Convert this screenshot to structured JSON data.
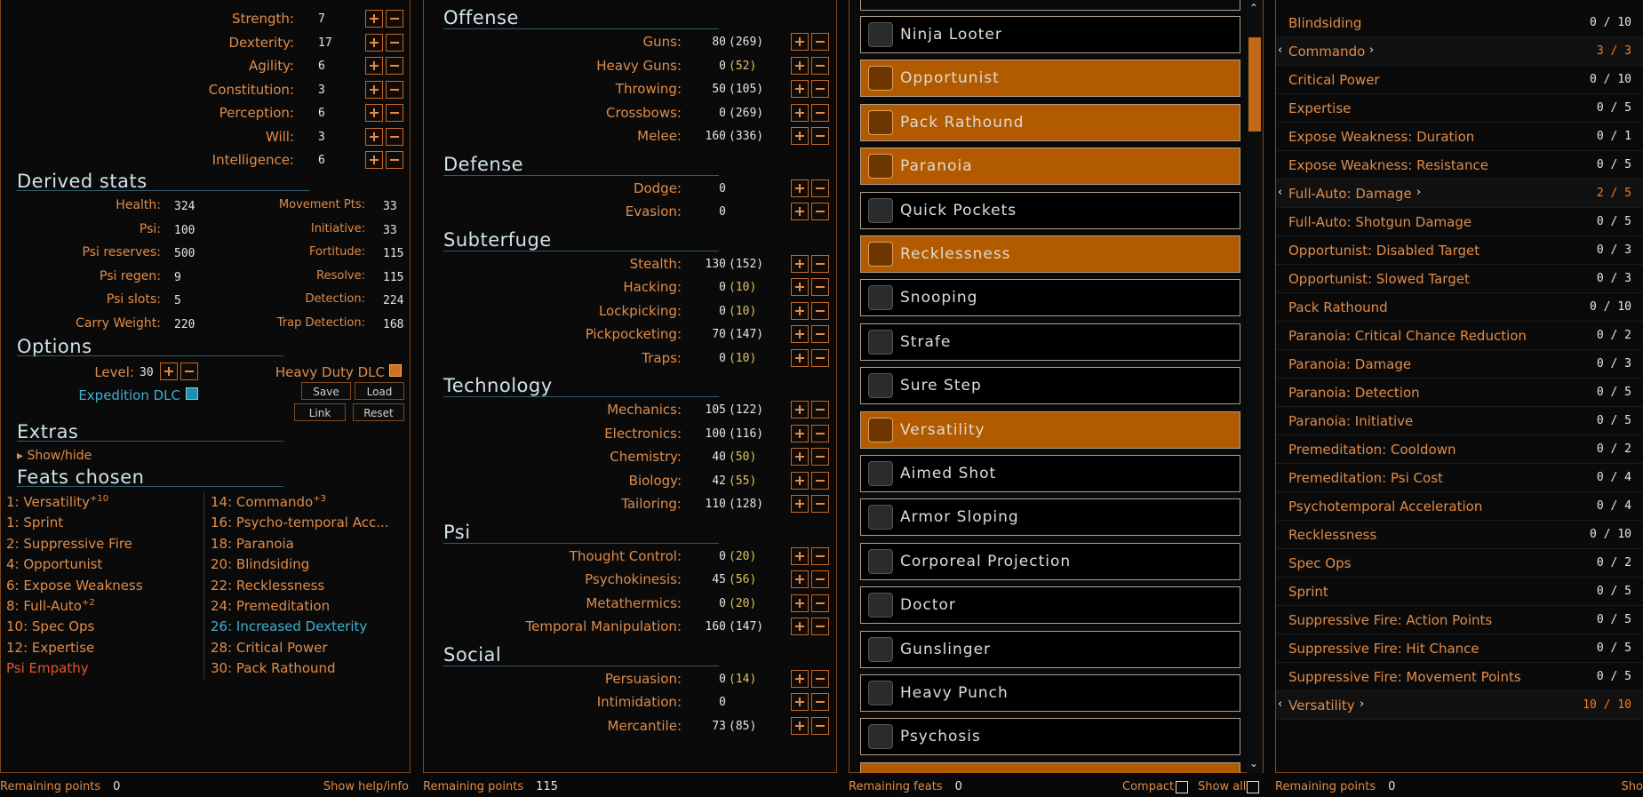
{
  "stats": {
    "attributes": [
      {
        "label": "Strength:",
        "value": "7"
      },
      {
        "label": "Dexterity:",
        "value": "17"
      },
      {
        "label": "Agility:",
        "value": "6"
      },
      {
        "label": "Constitution:",
        "value": "3"
      },
      {
        "label": "Perception:",
        "value": "6"
      },
      {
        "label": "Will:",
        "value": "3"
      },
      {
        "label": "Intelligence:",
        "value": "6"
      }
    ],
    "derived_title": "Derived stats",
    "derived_left": [
      {
        "label": "Health:",
        "value": "324"
      },
      {
        "label": "Psi:",
        "value": "100"
      },
      {
        "label": "Psi reserves:",
        "value": "500"
      },
      {
        "label": "Psi regen:",
        "value": "9"
      },
      {
        "label": "Psi slots:",
        "value": "5"
      },
      {
        "label": "Carry Weight:",
        "value": "220"
      }
    ],
    "derived_right": [
      {
        "label": "Movement Pts:",
        "value": "33"
      },
      {
        "label": "Initiative:",
        "value": "33"
      },
      {
        "label": "Fortitude:",
        "value": "115"
      },
      {
        "label": "Resolve:",
        "value": "115"
      },
      {
        "label": "Detection:",
        "value": "224"
      },
      {
        "label": "Trap Detection:",
        "value": "168"
      }
    ],
    "options_title": "Options",
    "level_label": "Level:",
    "level_value": "30",
    "heavy_duty_label": "Heavy Duty DLC",
    "expedition_label": "Expedition DLC",
    "save_label": "Save",
    "load_label": "Load",
    "link_label": "Link",
    "reset_label": "Reset",
    "extras_title": "Extras",
    "show_hide": "▸ Show/hide",
    "feats_title": "Feats chosen",
    "feats_left": [
      {
        "text": "1: Versatility",
        "sup": "+10",
        "color": "orange"
      },
      {
        "text": "1: Sprint",
        "sup": "",
        "color": "orange"
      },
      {
        "text": "2: Suppressive Fire",
        "sup": "",
        "color": "orange"
      },
      {
        "text": "4: Opportunist",
        "sup": "",
        "color": "orange"
      },
      {
        "text": "6: Expose Weakness",
        "sup": "",
        "color": "orange"
      },
      {
        "text": "8: Full-Auto",
        "sup": "+2",
        "color": "orange"
      },
      {
        "text": "10: Spec Ops",
        "sup": "",
        "color": "orange"
      },
      {
        "text": "12: Expertise",
        "sup": "",
        "color": "orange"
      },
      {
        "text": "Psi Empathy",
        "sup": "",
        "color": "red"
      }
    ],
    "feats_right": [
      {
        "text": "14: Commando",
        "sup": "+3",
        "color": "orange"
      },
      {
        "text": "16: Psycho-temporal Acc...",
        "sup": "",
        "color": "orange"
      },
      {
        "text": "18: Paranoia",
        "sup": "",
        "color": "orange"
      },
      {
        "text": "20: Blindsiding",
        "sup": "",
        "color": "orange"
      },
      {
        "text": "22: Recklessness",
        "sup": "",
        "color": "orange"
      },
      {
        "text": "24: Premeditation",
        "sup": "",
        "color": "orange"
      },
      {
        "text": "26: Increased Dexterity",
        "sup": "",
        "color": "cyan"
      },
      {
        "text": "28: Critical Power",
        "sup": "",
        "color": "orange"
      },
      {
        "text": "30: Pack Rathound",
        "sup": "",
        "color": "orange"
      }
    ],
    "remaining_label": "Remaining points",
    "remaining_value": "0",
    "help_label": "Show help/info"
  },
  "skills": {
    "sections": [
      {
        "title": "Offense",
        "rows": [
          {
            "label": "Guns:",
            "value": "80",
            "eff": "(269)",
            "eff_color": "white"
          },
          {
            "label": "Heavy Guns:",
            "value": "0",
            "eff": "(52)",
            "eff_color": "yellow"
          },
          {
            "label": "Throwing:",
            "value": "50",
            "eff": "(105)",
            "eff_color": "white"
          },
          {
            "label": "Crossbows:",
            "value": "0",
            "eff": "(269)",
            "eff_color": "white"
          },
          {
            "label": "Melee:",
            "value": "160",
            "eff": "(336)",
            "eff_color": "white"
          }
        ]
      },
      {
        "title": "Defense",
        "rows": [
          {
            "label": "Dodge:",
            "value": "0",
            "eff": "",
            "eff_color": "white"
          },
          {
            "label": "Evasion:",
            "value": "0",
            "eff": "",
            "eff_color": "white"
          }
        ]
      },
      {
        "title": "Subterfuge",
        "rows": [
          {
            "label": "Stealth:",
            "value": "130",
            "eff": "(152)",
            "eff_color": "white"
          },
          {
            "label": "Hacking:",
            "value": "0",
            "eff": "(10)",
            "eff_color": "yellow"
          },
          {
            "label": "Lockpicking:",
            "value": "0",
            "eff": "(10)",
            "eff_color": "yellow"
          },
          {
            "label": "Pickpocketing:",
            "value": "70",
            "eff": "(147)",
            "eff_color": "white"
          },
          {
            "label": "Traps:",
            "value": "0",
            "eff": "(10)",
            "eff_color": "yellow"
          }
        ]
      },
      {
        "title": "Technology",
        "rows": [
          {
            "label": "Mechanics:",
            "value": "105",
            "eff": "(122)",
            "eff_color": "white"
          },
          {
            "label": "Electronics:",
            "value": "100",
            "eff": "(116)",
            "eff_color": "white"
          },
          {
            "label": "Chemistry:",
            "value": "40",
            "eff": "(50)",
            "eff_color": "yellow"
          },
          {
            "label": "Biology:",
            "value": "42",
            "eff": "(55)",
            "eff_color": "yellow"
          },
          {
            "label": "Tailoring:",
            "value": "110",
            "eff": "(128)",
            "eff_color": "white"
          }
        ]
      },
      {
        "title": "Psi",
        "rows": [
          {
            "label": "Thought Control:",
            "value": "0",
            "eff": "(20)",
            "eff_color": "yellow"
          },
          {
            "label": "Psychokinesis:",
            "value": "45",
            "eff": "(56)",
            "eff_color": "yellow"
          },
          {
            "label": "Metathermics:",
            "value": "0",
            "eff": "(20)",
            "eff_color": "yellow"
          },
          {
            "label": "Temporal Manipulation:",
            "value": "160",
            "eff": "(147)",
            "eff_color": "white"
          }
        ]
      },
      {
        "title": "Social",
        "rows": [
          {
            "label": "Persuasion:",
            "value": "0",
            "eff": "(14)",
            "eff_color": "yellow"
          },
          {
            "label": "Intimidation:",
            "value": "0",
            "eff": "",
            "eff_color": "white"
          },
          {
            "label": "Mercantile:",
            "value": "73",
            "eff": "(85)",
            "eff_color": "white"
          }
        ]
      }
    ],
    "remaining_label": "Remaining points",
    "remaining_value": "115"
  },
  "feats": {
    "items": [
      {
        "name": "Ninja Looter",
        "selected": false,
        "icon": "ninja-looter-icon"
      },
      {
        "name": "Opportunist",
        "selected": true,
        "icon": "opportunist-icon"
      },
      {
        "name": "Pack Rathound",
        "selected": true,
        "icon": "pack-rathound-icon"
      },
      {
        "name": "Paranoia",
        "selected": true,
        "icon": "paranoia-icon"
      },
      {
        "name": "Quick Pockets",
        "selected": false,
        "icon": "quick-pockets-icon"
      },
      {
        "name": "Recklessness",
        "selected": true,
        "icon": "recklessness-icon"
      },
      {
        "name": "Snooping",
        "selected": false,
        "icon": "snooping-icon"
      },
      {
        "name": "Strafe",
        "selected": false,
        "icon": "strafe-icon"
      },
      {
        "name": "Sure Step",
        "selected": false,
        "icon": "sure-step-icon"
      },
      {
        "name": "Versatility",
        "selected": true,
        "icon": "versatility-icon"
      },
      {
        "name": "Aimed Shot",
        "selected": false,
        "icon": "aimed-shot-icon"
      },
      {
        "name": "Armor Sloping",
        "selected": false,
        "icon": "armor-sloping-icon"
      },
      {
        "name": "Corporeal Projection",
        "selected": false,
        "icon": "corporeal-projection-icon"
      },
      {
        "name": "Doctor",
        "selected": false,
        "icon": "doctor-icon"
      },
      {
        "name": "Gunslinger",
        "selected": false,
        "icon": "gunslinger-icon"
      },
      {
        "name": "Heavy Punch",
        "selected": false,
        "icon": "heavy-punch-icon"
      },
      {
        "name": "Psychosis",
        "selected": false,
        "icon": "psychosis-icon"
      }
    ],
    "remaining_label": "Remaining feats",
    "remaining_value": "0",
    "compact_label": "Compact",
    "show_all_label": "Show all"
  },
  "specializations": {
    "rows": [
      {
        "name": "Blindsiding",
        "count": "0 / 10",
        "hi": false
      },
      {
        "name": "Commando",
        "count": "3 / 3",
        "hi": true
      },
      {
        "name": "Critical Power",
        "count": "0 / 10",
        "hi": false
      },
      {
        "name": "Expertise",
        "count": "0 / 5",
        "hi": false
      },
      {
        "name": "Expose Weakness: Duration",
        "count": "0 / 1",
        "hi": false
      },
      {
        "name": "Expose Weakness: Resistance",
        "count": "0 / 5",
        "hi": false
      },
      {
        "name": "Full-Auto: Damage",
        "count": "2 / 5",
        "hi": true
      },
      {
        "name": "Full-Auto: Shotgun Damage",
        "count": "0 / 5",
        "hi": false
      },
      {
        "name": "Opportunist: Disabled Target",
        "count": "0 / 3",
        "hi": false
      },
      {
        "name": "Opportunist: Slowed Target",
        "count": "0 / 3",
        "hi": false
      },
      {
        "name": "Pack Rathound",
        "count": "0 / 10",
        "hi": false
      },
      {
        "name": "Paranoia: Critical Chance Reduction",
        "count": "0 / 2",
        "hi": false
      },
      {
        "name": "Paranoia: Damage",
        "count": "0 / 3",
        "hi": false
      },
      {
        "name": "Paranoia: Detection",
        "count": "0 / 5",
        "hi": false
      },
      {
        "name": "Paranoia: Initiative",
        "count": "0 / 5",
        "hi": false
      },
      {
        "name": "Premeditation: Cooldown",
        "count": "0 / 2",
        "hi": false
      },
      {
        "name": "Premeditation: Psi Cost",
        "count": "0 / 4",
        "hi": false
      },
      {
        "name": "Psychotemporal Acceleration",
        "count": "0 / 4",
        "hi": false
      },
      {
        "name": "Recklessness",
        "count": "0 / 10",
        "hi": false
      },
      {
        "name": "Spec Ops",
        "count": "0 / 2",
        "hi": false
      },
      {
        "name": "Sprint",
        "count": "0 / 5",
        "hi": false
      },
      {
        "name": "Suppressive Fire: Action Points",
        "count": "0 / 5",
        "hi": false
      },
      {
        "name": "Suppressive Fire: Hit Chance",
        "count": "0 / 5",
        "hi": false
      },
      {
        "name": "Suppressive Fire: Movement Points",
        "count": "0 / 5",
        "hi": false
      },
      {
        "name": "Versatility",
        "count": "10 / 10",
        "hi": true
      }
    ],
    "remaining_label": "Remaining points",
    "remaining_value": "0",
    "cut_label": "Sho"
  },
  "colors": {
    "accent": "#e08c4a",
    "selected": "#b25a00",
    "heading": "#cfe3ea",
    "cyan": "#3fb0cf",
    "yellow": "#e2c45a"
  }
}
